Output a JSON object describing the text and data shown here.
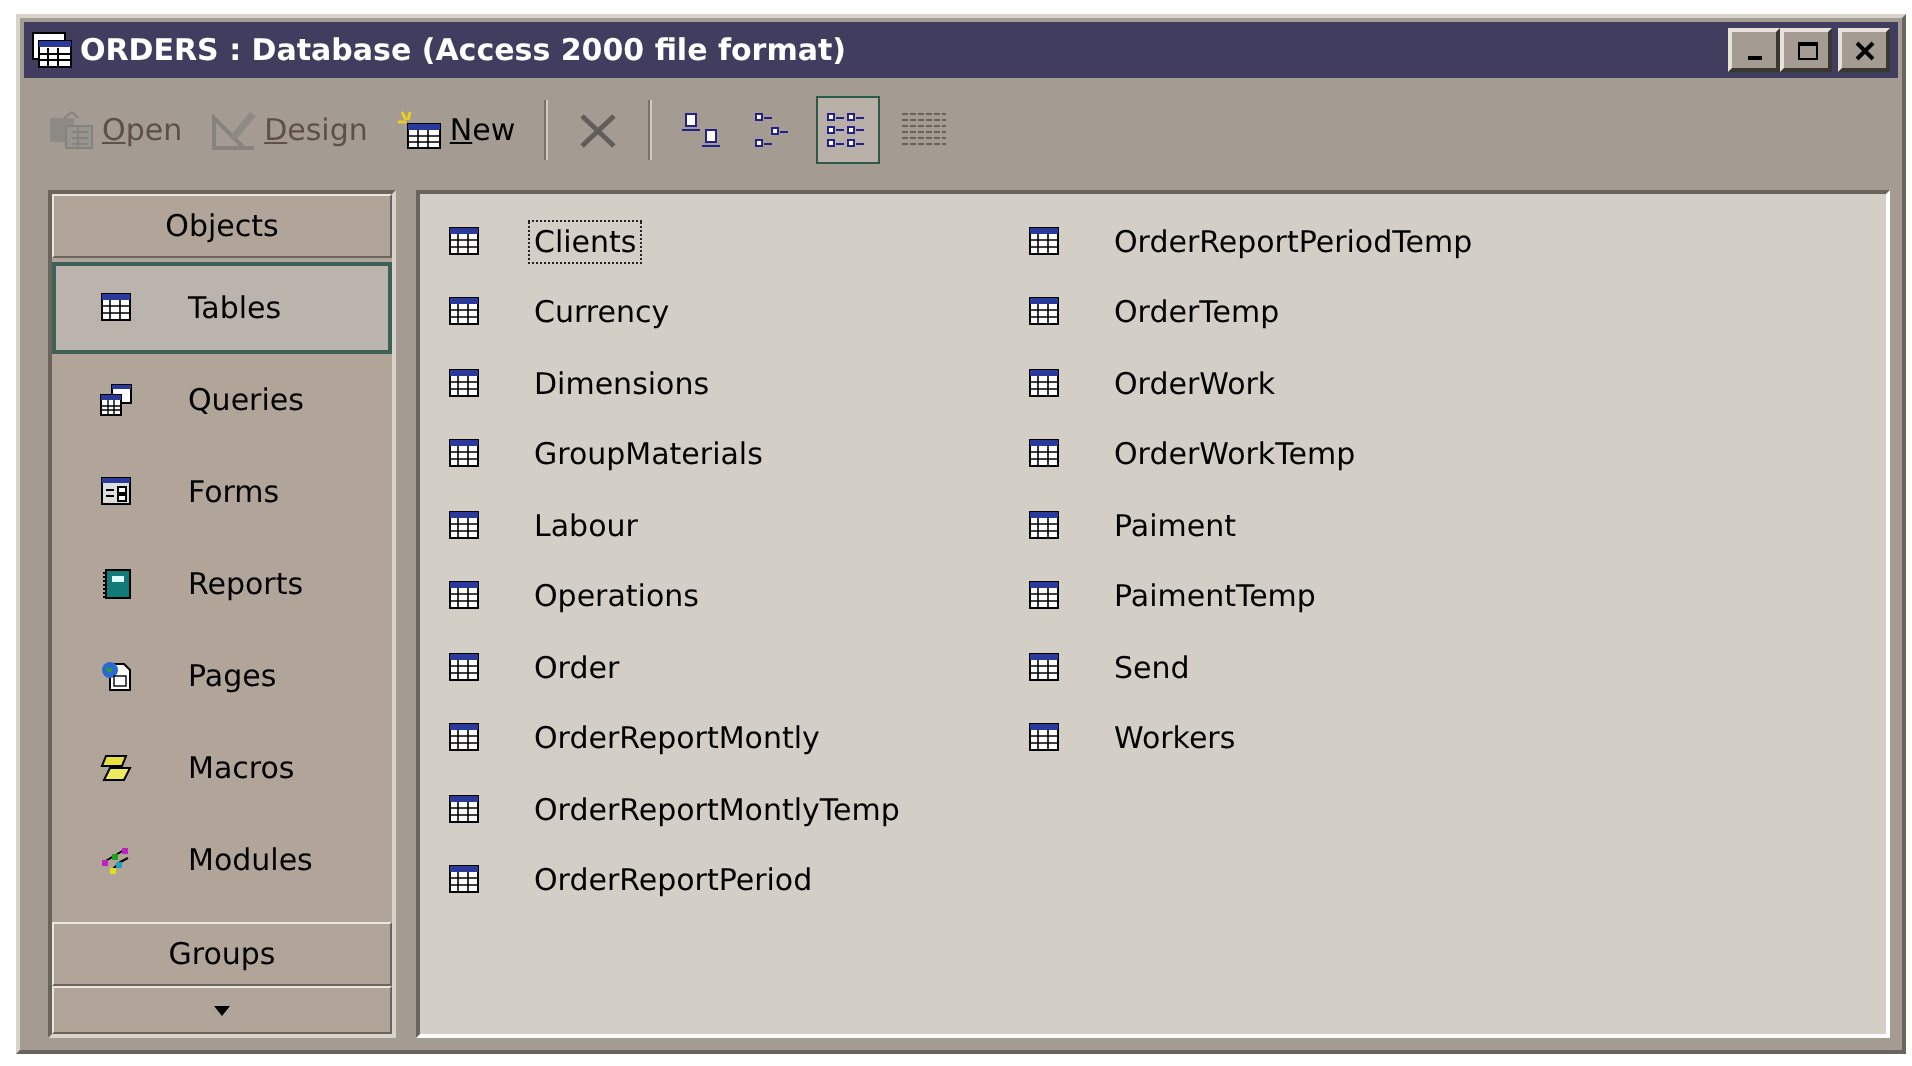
{
  "window": {
    "title": "ORDERS : Database (Access 2000 file format)"
  },
  "toolbar": [
    {
      "kind": "open",
      "label": "Open",
      "disabled": true,
      "selected": false
    },
    {
      "kind": "design",
      "label": "Design",
      "disabled": true,
      "selected": false
    },
    {
      "kind": "new",
      "label": "New",
      "disabled": false,
      "selected": false
    },
    {
      "kind": "separator"
    },
    {
      "kind": "delete",
      "disabled": true,
      "selected": false
    },
    {
      "kind": "separator"
    },
    {
      "kind": "large",
      "disabled": false,
      "selected": false
    },
    {
      "kind": "small",
      "disabled": false,
      "selected": false
    },
    {
      "kind": "list",
      "disabled": false,
      "selected": true
    },
    {
      "kind": "details",
      "disabled": false,
      "selected": false
    }
  ],
  "sidebar": {
    "header": "Objects",
    "items": [
      {
        "kind": "tables",
        "label": "Tables",
        "selected": true
      },
      {
        "kind": "queries",
        "label": "Queries",
        "selected": false
      },
      {
        "kind": "forms",
        "label": "Forms",
        "selected": false
      },
      {
        "kind": "reports",
        "label": "Reports",
        "selected": false
      },
      {
        "kind": "pages",
        "label": "Pages",
        "selected": false
      },
      {
        "kind": "macros",
        "label": "Macros",
        "selected": false
      },
      {
        "kind": "modules",
        "label": "Modules",
        "selected": false
      }
    ],
    "groups_header": "Groups"
  },
  "tables": [
    {
      "name": "Clients",
      "selected": true
    },
    {
      "name": "Currency",
      "selected": false
    },
    {
      "name": "Dimensions",
      "selected": false
    },
    {
      "name": "GroupMaterials",
      "selected": false
    },
    {
      "name": "Labour",
      "selected": false
    },
    {
      "name": "Operations",
      "selected": false
    },
    {
      "name": "Order",
      "selected": false
    },
    {
      "name": "OrderReportMontly",
      "selected": false
    },
    {
      "name": "OrderReportMontlyTemp",
      "selected": false
    },
    {
      "name": "OrderReportPeriod",
      "selected": false
    },
    {
      "name": "OrderReportPeriodTemp",
      "selected": false
    },
    {
      "name": "OrderTemp",
      "selected": false
    },
    {
      "name": "OrderWork",
      "selected": false
    },
    {
      "name": "OrderWorkTemp",
      "selected": false
    },
    {
      "name": "Paiment",
      "selected": false
    },
    {
      "name": "PaimentTemp",
      "selected": false
    },
    {
      "name": "Send",
      "selected": false
    },
    {
      "name": "Workers",
      "selected": false
    }
  ]
}
